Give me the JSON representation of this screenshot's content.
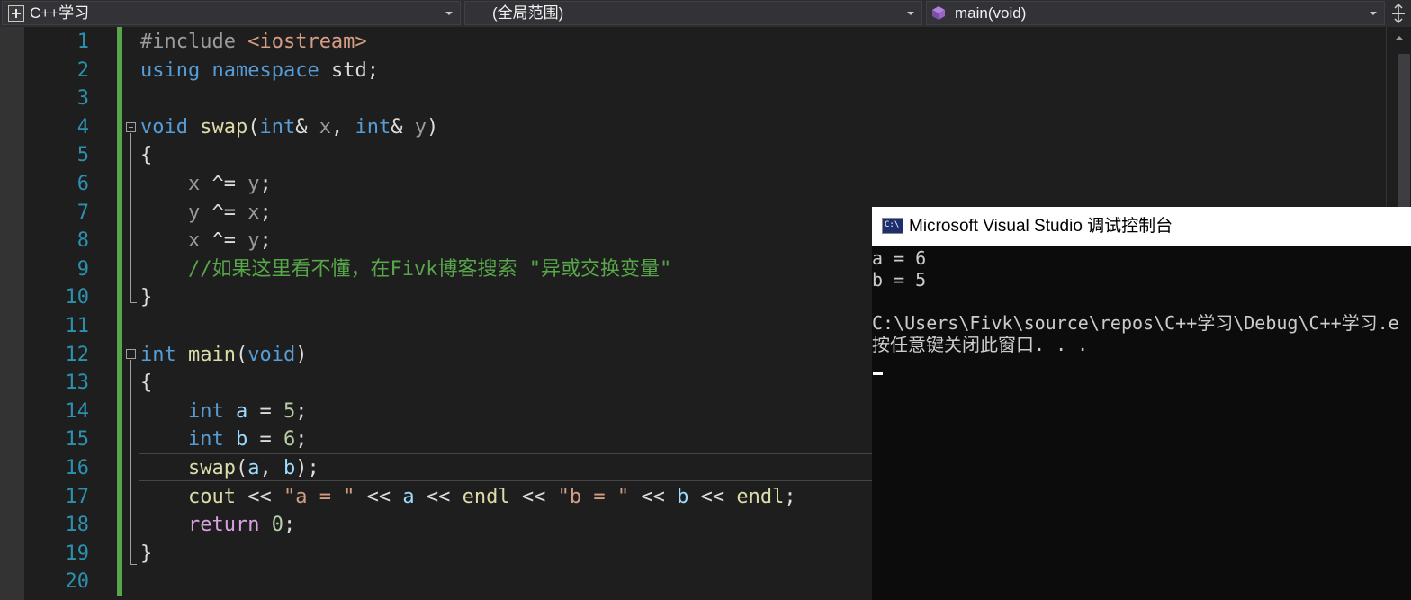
{
  "navbar": {
    "project": "C++学习",
    "scope": "(全局范围)",
    "member": "main(void)"
  },
  "editor": {
    "line_numbers": [
      "1",
      "2",
      "3",
      "4",
      "5",
      "6",
      "7",
      "8",
      "9",
      "10",
      "11",
      "12",
      "13",
      "14",
      "15",
      "16",
      "17",
      "18",
      "19",
      "20"
    ],
    "code": {
      "l1": {
        "directive": "#include",
        "header": "<iostream>"
      },
      "l2": {
        "kw_using": "using",
        "kw_namespace": "namespace",
        "ns": "std",
        "semi": ";"
      },
      "l4": {
        "kw_void": "void",
        "fn": "swap",
        "open": "(",
        "kw_int1": "int",
        "amp1": "&",
        "p1": "x",
        "comma": ",",
        "kw_int2": "int",
        "amp2": "&",
        "p2": "y",
        "close": ")"
      },
      "l5": {
        "brace": "{"
      },
      "l6": {
        "a": "x",
        "op": " ^= ",
        "b": "y",
        "semi": ";"
      },
      "l7": {
        "a": "y",
        "op": " ^= ",
        "b": "x",
        "semi": ";"
      },
      "l8": {
        "a": "x",
        "op": " ^= ",
        "b": "y",
        "semi": ";"
      },
      "l9": {
        "comment": "//如果这里看不懂，在Fivk博客搜索 \"异或交换变量\""
      },
      "l10": {
        "brace": "}"
      },
      "l12": {
        "kw_int": "int",
        "fn": "main",
        "open": "(",
        "kw_void": "void",
        "close": ")"
      },
      "l13": {
        "brace": "{"
      },
      "l14": {
        "kw_int": "int",
        "var": "a",
        "op": " = ",
        "num": "5",
        "semi": ";"
      },
      "l15": {
        "kw_int": "int",
        "var": "b",
        "op": " = ",
        "num": "6",
        "semi": ";"
      },
      "l16": {
        "fn": "swap",
        "open": "(",
        "v1": "a",
        "comma": ", ",
        "v2": "b",
        "close": ")",
        "semi": ";"
      },
      "l17": {
        "cout": "cout",
        "op1": " << ",
        "s1": "\"a = \"",
        "op2": " << ",
        "v1": "a",
        "op3": " << ",
        "endl1": "endl",
        "op4": " << ",
        "s2": "\"b = \"",
        "op5": " << ",
        "v2": "b",
        "op6": " << ",
        "endl2": "endl",
        "semi": ";"
      },
      "l18": {
        "kw_return": "return",
        "num": "0",
        "semi": ";"
      },
      "l19": {
        "brace": "}"
      }
    }
  },
  "console": {
    "title": "Microsoft Visual Studio 调试控制台",
    "lines": [
      "a = 6",
      "b = 5",
      "",
      "C:\\Users\\Fivk\\source\\repos\\C++学习\\Debug\\C++学习.e",
      "按任意键关闭此窗口. . ."
    ]
  },
  "colors": {
    "keyword": "#569cd6",
    "function": "#dcdcaa",
    "string": "#d69d85",
    "number": "#b5cea8",
    "comment": "#57a64a",
    "variable": "#9cdcfe",
    "namespace": "#4ec9b0",
    "control": "#d8a0df",
    "line_number": "#2b91af",
    "editor_bg": "#1e1e1e",
    "console_bg": "#0c0c0c"
  },
  "icons": {
    "project": "cpp-project-icon",
    "member": "method-cube-icon",
    "console": "console-app-icon",
    "split": "split-window-icon"
  }
}
